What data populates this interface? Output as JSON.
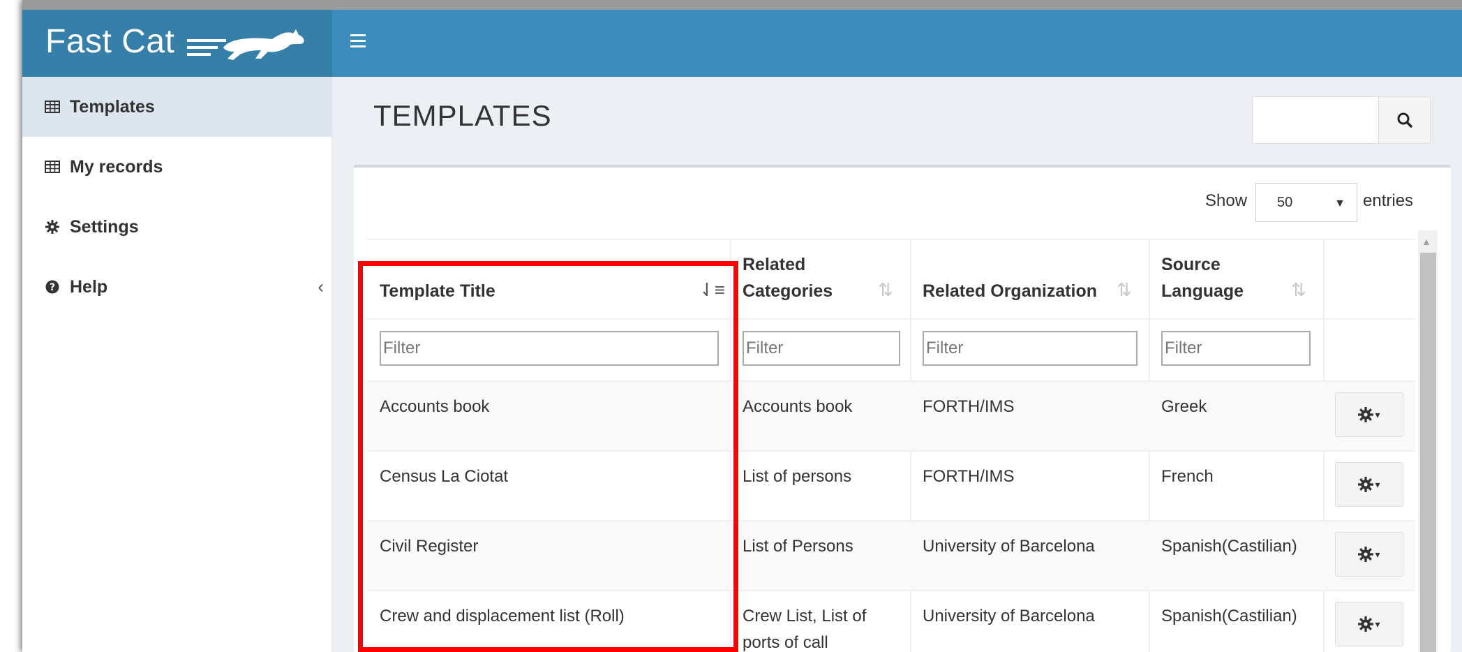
{
  "app": {
    "name": "Fast Cat"
  },
  "page": {
    "title": "TEMPLATES",
    "search_placeholder": ""
  },
  "sidebar": {
    "items": [
      {
        "label": "Templates",
        "icon": "table-icon"
      },
      {
        "label": "My records",
        "icon": "table-icon"
      },
      {
        "label": "Settings",
        "icon": "gear-icon"
      },
      {
        "label": "Help",
        "icon": "question-circle-icon"
      }
    ]
  },
  "length_menu": {
    "show_label": "Show",
    "selected": "50",
    "entries_label": "entries"
  },
  "table": {
    "columns": [
      {
        "line1": "Template Title",
        "line2": ""
      },
      {
        "line1": "Related",
        "line2": "Categories"
      },
      {
        "line1": "Related Organization",
        "line2": ""
      },
      {
        "line1": "Source",
        "line2": "Language"
      }
    ],
    "filter_placeholder": "Filter",
    "rows": [
      {
        "title": "Accounts book",
        "categories": "Accounts book",
        "categories2": "",
        "organization": "FORTH/IMS",
        "language": "Greek"
      },
      {
        "title": "Census La Ciotat",
        "categories": "List of persons",
        "categories2": "",
        "organization": "FORTH/IMS",
        "language": "French"
      },
      {
        "title": "Civil Register",
        "categories": "List of Persons",
        "categories2": "",
        "organization": "University of Barcelona",
        "language": "Spanish(Castilian)"
      },
      {
        "title": "Crew and displacement list (Roll)",
        "categories": "Crew List, List of",
        "categories2": "ports of call",
        "organization": "University of Barcelona",
        "language": "Spanish(Castilian)"
      }
    ]
  },
  "colors": {
    "header": "#3c8dbc",
    "logo_bg": "#367fa9",
    "highlight": "#ff0000"
  }
}
